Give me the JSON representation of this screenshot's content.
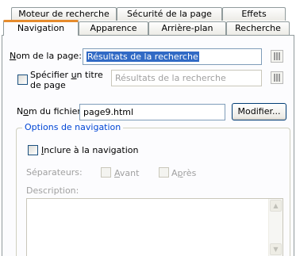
{
  "tabs_back": [
    "Moteur de recherche",
    "Sécurité de la page",
    "Effets"
  ],
  "tabs_front": [
    "Navigation",
    "Apparence",
    "Arrière-plan",
    "Recherche"
  ],
  "page_name": {
    "label_u": "N",
    "label_rest": "om de la page:",
    "value": "Résultats de la recherche"
  },
  "title": {
    "label_line1_pre": "Spécifier ",
    "label_line1_u": "u",
    "label_line1_post": "n titre",
    "label_line2": "de page",
    "value": "Résultats de la recherche"
  },
  "file_name": {
    "label_pre": "N",
    "label_u": "o",
    "label_post": "m du fichier:",
    "value": "page9.html",
    "modify_button": "Modifier..."
  },
  "nav_options": {
    "title": "Options de navigation",
    "include_u": "I",
    "include_rest": "nclure à la navigation",
    "separators_label": "Séparateurs:",
    "before_u": "A",
    "before_rest": "vant",
    "after_pre": "A",
    "after_u": "p",
    "after_post": "rès",
    "description_label": "Description:"
  },
  "icons": {
    "scroll_up": "▲",
    "scroll_down": "▼"
  }
}
